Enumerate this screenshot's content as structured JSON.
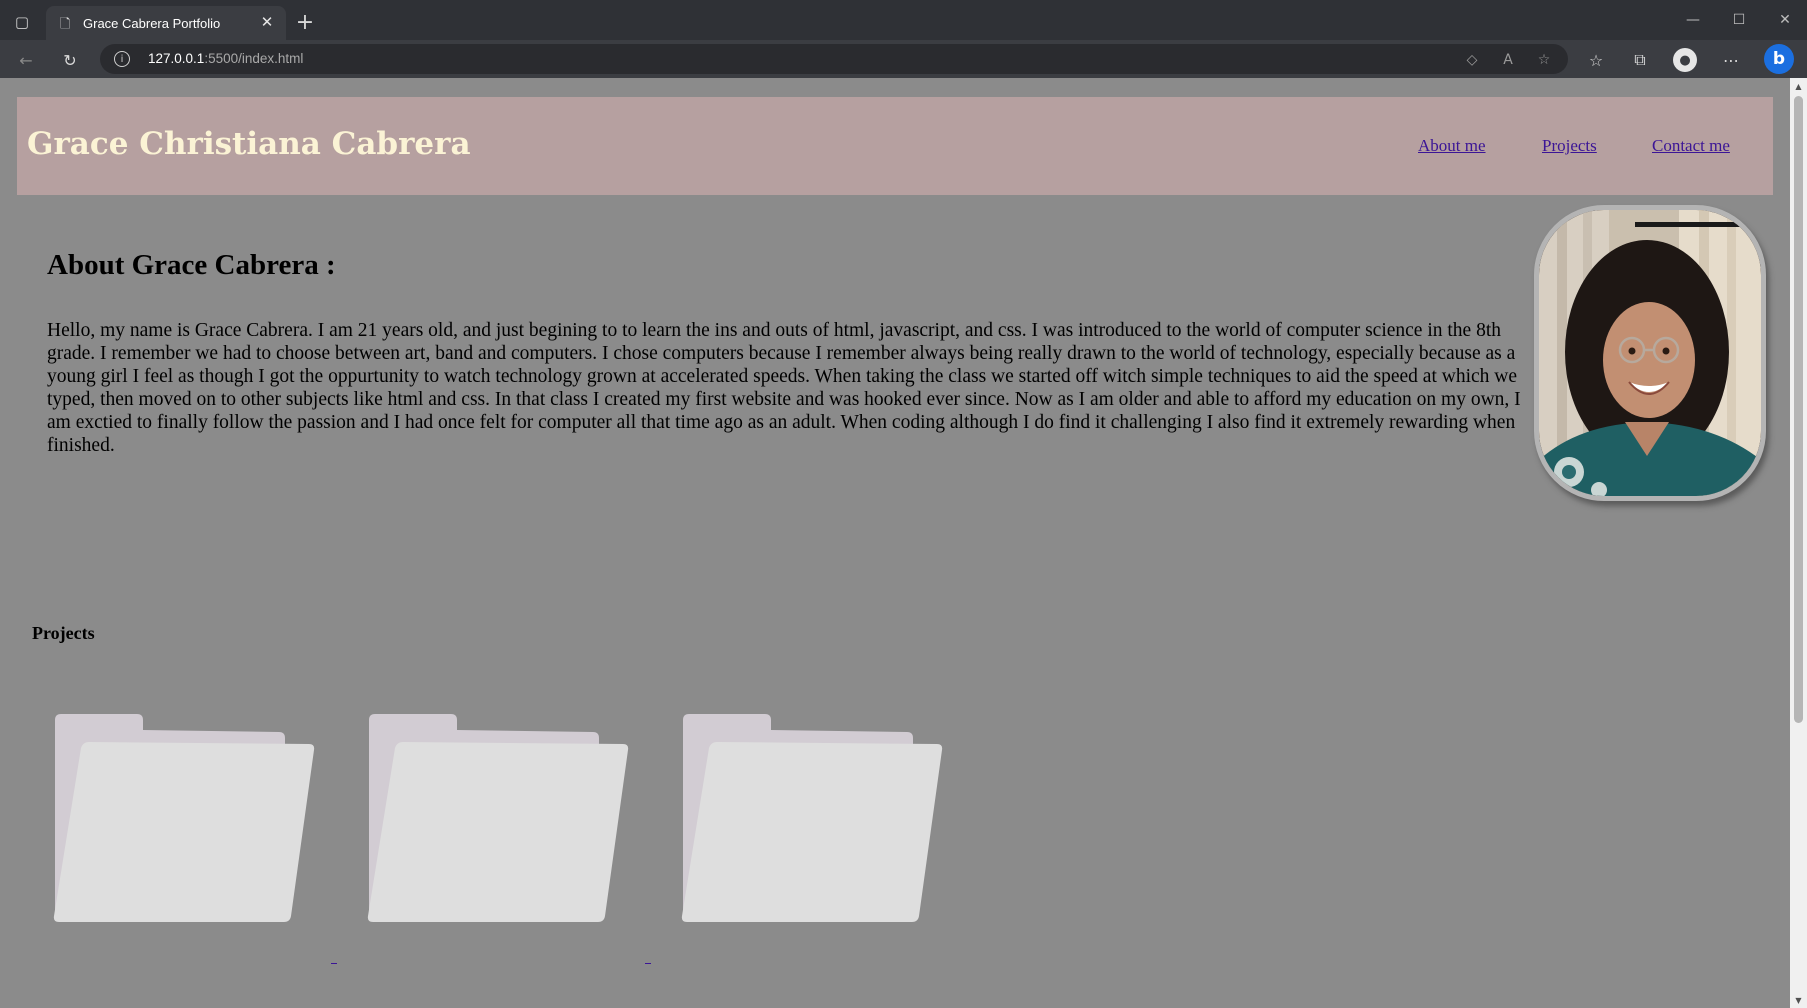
{
  "browser": {
    "tab_title": "Grace Cabrera Portfolio",
    "url_host": "127.0.0.1",
    "url_path": ":5500/index.html",
    "icons": {
      "tab_actions": "tab-actions-icon",
      "favicon": "page-icon",
      "close_tab": "close-icon",
      "new_tab": "plus-icon",
      "back": "back-arrow-icon",
      "refresh": "refresh-icon",
      "site_info": "info-icon",
      "tracking": "tag-icon",
      "read_aloud": "read-aloud-icon",
      "add_favorite": "star-add-icon",
      "favorites": "favorites-icon",
      "collections": "collections-icon",
      "profile": "profile-icon",
      "more": "more-icon",
      "copilot": "bing-icon"
    }
  },
  "site": {
    "title": "Grace Christiana Cabrera",
    "nav": [
      {
        "label": "About me"
      },
      {
        "label": "Projects"
      },
      {
        "label": "Contact me"
      }
    ],
    "about": {
      "heading": "About Grace Cabrera :",
      "body": "Hello, my name is Grace Cabrera. I am 21 years old, and just begining to to learn the ins and outs of html, javascript, and css. I was introduced to the world of computer science in the 8th grade. I remember we had to choose between art, band and computers. I chose computers because I remember always being really drawn to the world of technology, especially because as a young girl I feel as though I got the oppurtunity to watch technology grown at accelerated speeds. When taking the class we started off witch simple techniques to aid the speed at which we typed, then moved on to other subjects like html and css. In that class I created my first website and was hooked ever since. Now as I am older and able to afford my education on my own, I am exctied to finally follow the passion and I had once felt for computer all that time ago as an adult. When coding although I do find it challenging I also find it extremely rewarding when finished."
    },
    "projects": {
      "heading": "Projects",
      "folders": 3
    }
  },
  "colors": {
    "page_bg": "#8b8b8b",
    "header_bg": "#b6a0a0",
    "title_color": "#fbf3d5",
    "link_color": "#3b1596"
  }
}
